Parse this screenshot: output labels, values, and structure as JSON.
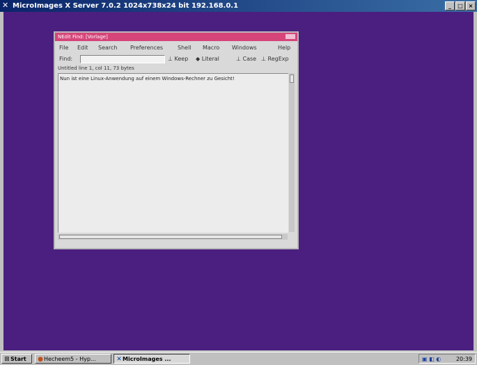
{
  "xserver": {
    "title": "MicroImages X Server 7.0.2 1024x738x24 bit 192.168.0.1",
    "icon": "x-icon",
    "controls": [
      "minimize",
      "maximize",
      "close"
    ]
  },
  "nedit": {
    "title": "NEdit Find: [Vorlage]",
    "menu": [
      "File",
      "Edit",
      "Search",
      "Preferences",
      "Shell",
      "Macro",
      "Windows",
      "Help"
    ],
    "find_label": "Find:",
    "find_value": "",
    "options": [
      "Keep",
      "Literal",
      "Case",
      "RegExp"
    ],
    "status": "Untitled line 1, col 11, 73 bytes",
    "text": "Nun ist eine Linux-Anwendung auf einem Windows-Rechner zu Gesicht!"
  },
  "taskbar": {
    "start": "Start",
    "buttons": [
      {
        "label": "Hecheem5 - Hyp...",
        "icon": "browser-icon"
      },
      {
        "label": "MicroImages ...",
        "icon": "x-icon"
      }
    ],
    "clock": "20:39"
  }
}
